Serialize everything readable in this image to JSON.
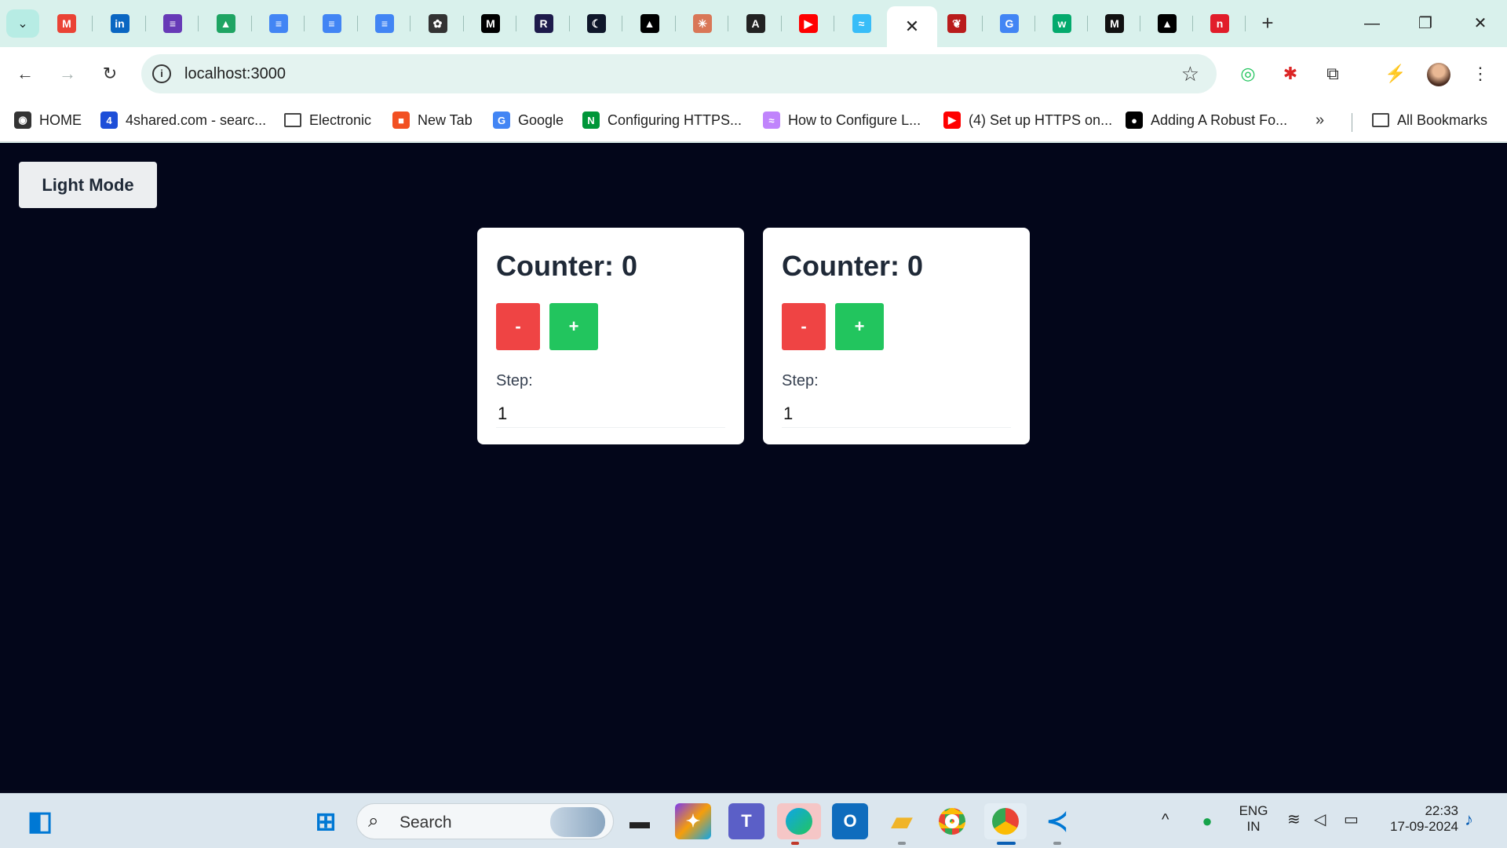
{
  "browser": {
    "tabs": [
      {
        "icon": "gmail-icon",
        "glyph": "M",
        "color": "#ea4335"
      },
      {
        "icon": "linkedin-icon",
        "glyph": "in",
        "color": "#0a66c2"
      },
      {
        "icon": "forms-icon",
        "glyph": "≡",
        "color": "#673ab7"
      },
      {
        "icon": "drive-icon",
        "glyph": "▲",
        "color": "#1fa463"
      },
      {
        "icon": "docs-icon",
        "glyph": "≡",
        "color": "#4285f4"
      },
      {
        "icon": "docs-icon",
        "glyph": "≡",
        "color": "#4285f4"
      },
      {
        "icon": "docs-icon",
        "glyph": "≡",
        "color": "#4285f4"
      },
      {
        "icon": "chatgpt-icon",
        "glyph": "✿",
        "color": "#333333"
      },
      {
        "icon": "medium-icon",
        "glyph": "M",
        "color": "#000000"
      },
      {
        "icon": "r-icon",
        "glyph": "R",
        "color": "#1e1b4b"
      },
      {
        "icon": "moon-icon",
        "glyph": "☾",
        "color": "#0f172a"
      },
      {
        "icon": "triangle-icon",
        "glyph": "▲",
        "color": "#000000"
      },
      {
        "icon": "claude-icon",
        "glyph": "✳",
        "color": "#d97757"
      },
      {
        "icon": "anthropic-icon",
        "glyph": "A",
        "color": "#222222"
      },
      {
        "icon": "youtube-icon",
        "glyph": "▶",
        "color": "#ff0000"
      },
      {
        "icon": "tailwind-icon",
        "glyph": "≈",
        "color": "#38bdf8"
      }
    ],
    "active_tab_close": "✕",
    "tabs_after": [
      {
        "icon": "cherry-icon",
        "glyph": "❦",
        "color": "#b91c1c"
      },
      {
        "icon": "google-icon",
        "glyph": "G",
        "color": "#4285f4"
      },
      {
        "icon": "w3schools-icon",
        "glyph": "w",
        "color": "#04aa6d"
      },
      {
        "icon": "m-icon",
        "glyph": "M",
        "color": "#111111"
      },
      {
        "icon": "triangle-icon",
        "glyph": "▲",
        "color": "#000000"
      },
      {
        "icon": "n-icon",
        "glyph": "n",
        "color": "#e11d2a"
      }
    ],
    "new_tab": "+",
    "window_controls": {
      "minimize": "—",
      "restore": "❐",
      "close": "✕"
    },
    "nav": {
      "back": "←",
      "forward": "→",
      "reload": "↻"
    },
    "url": "localhost:3000",
    "info_glyph": "i",
    "star": "☆",
    "menu": "⋮",
    "bookmarks": [
      {
        "label": "HOME",
        "icon": "globe-icon",
        "glyph": "◉",
        "color": "#333333"
      },
      {
        "label": "4shared.com - searc...",
        "icon": "4shared-icon",
        "glyph": "4",
        "color": "#1d4ed8"
      },
      {
        "label": "Electronic",
        "icon": "folder-icon"
      },
      {
        "label": "New Tab",
        "icon": "windows-icon",
        "glyph": "■",
        "color": "#f25022"
      },
      {
        "label": "Google",
        "icon": "google-icon",
        "glyph": "G",
        "color": "#4285f4"
      },
      {
        "label": "Configuring HTTPS...",
        "icon": "nginx-icon",
        "glyph": "N",
        "color": "#009639"
      },
      {
        "label": "How to Configure L...",
        "icon": "link-icon",
        "glyph": "≈",
        "color": "#c084fc"
      },
      {
        "label": "(4) Set up HTTPS on...",
        "icon": "youtube-icon",
        "glyph": "▶",
        "color": "#ff0000"
      },
      {
        "label": "Adding A Robust Fo...",
        "icon": "medium-icon",
        "glyph": "●",
        "color": "#000000"
      }
    ],
    "bookmarks_more": "»",
    "all_bookmarks": "All Bookmarks"
  },
  "app": {
    "mode_button": "Light Mode",
    "counters": [
      {
        "title": "Counter: 0",
        "dec": "-",
        "inc": "+",
        "step_label": "Step:",
        "step_value": "1"
      },
      {
        "title": "Counter: 0",
        "dec": "-",
        "inc": "+",
        "step_label": "Step:",
        "step_value": "1"
      }
    ],
    "colors": {
      "background": "#03061a",
      "decrement": "#ef4444",
      "increment": "#22c55e"
    }
  },
  "taskbar": {
    "search_placeholder": "Search",
    "language": "ENG",
    "region": "IN",
    "time": "22:33",
    "date": "17-09-2024",
    "tray_up": "^"
  }
}
